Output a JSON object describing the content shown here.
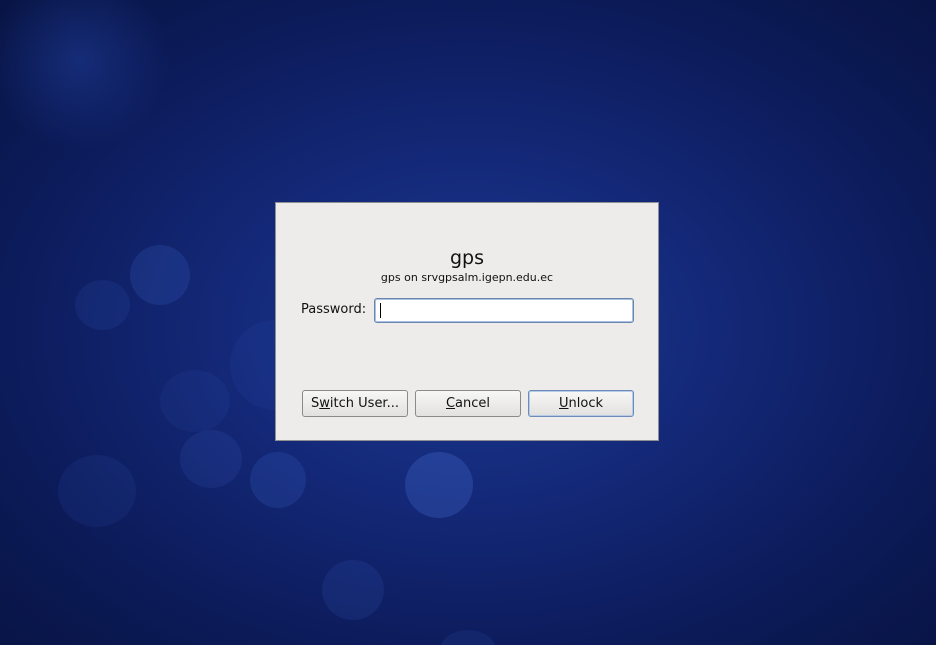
{
  "dialog": {
    "title": "gps",
    "subtitle": "gps on srvgpsalm.igepn.edu.ec",
    "password_label": "Password:",
    "password_value": "",
    "buttons": {
      "switch_user": {
        "pre": "S",
        "mnemonic": "w",
        "post": "itch User..."
      },
      "cancel": {
        "pre": "",
        "mnemonic": "C",
        "post": "ancel"
      },
      "unlock": {
        "pre": "",
        "mnemonic": "U",
        "post": "nlock"
      }
    }
  },
  "colors": {
    "background": "#14297a",
    "dialog_bg": "#edeceb",
    "focus_border": "#6b87b0"
  }
}
